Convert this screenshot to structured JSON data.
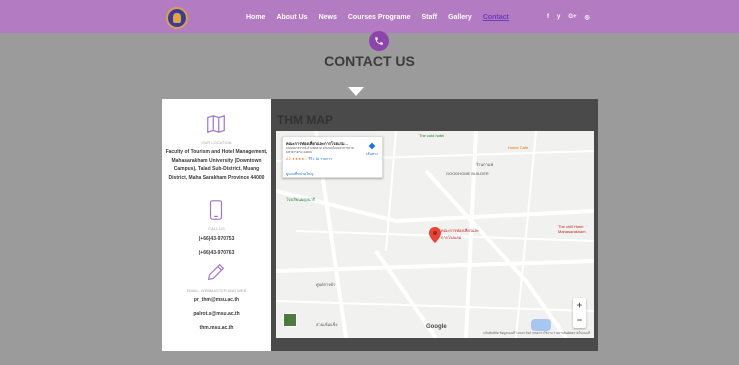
{
  "nav": {
    "items": [
      "Home",
      "About Us",
      "News",
      "Courses Programe",
      "Staff",
      "Gallery",
      "Contact"
    ],
    "active": "Contact",
    "social": [
      "f",
      "y",
      "G+",
      "◎"
    ]
  },
  "header": {
    "title": "CONTACT US"
  },
  "card": {
    "location_label": "OUR LOCATION",
    "address": "Faculty of Tourism and Hotel Management, Mahasarakham University (Downtown Campus), Talad Sub-District, Muang District, Maha Sarakham Province 44000",
    "call_label": "CALL US",
    "phone1": "(+66)43-970753",
    "phone2": "(+66)43-970763",
    "email_label": "EMAIL, WEBMASTER AND WEB",
    "email1": "pr_thm@msu.ac.th",
    "email2": "palrot.s@msu.ac.th",
    "web": "thm.msu.ac.th"
  },
  "map": {
    "title": "THM MAP",
    "place_name": "คณะการท่องเที่ยวและการโรงแรม...",
    "place_address": "ถนนนครสวรรค์ ตำบลตลาด อำเภอเมืองมหาสารคาม มหาสารคาม 44000",
    "rating": "4.2",
    "stars": "★★★★☆",
    "reviews": "รีวิว 16 รายการ",
    "directions": "เส้นทาง",
    "larger_map": "ดูแผนที่ขนาดใหญ่",
    "google": "Google",
    "attribution": "แป้นพิมพ์ลัด  ข้อมูลแผนที่ ©2023  ข้อกำหนดการใช้งาน  รายงานข้อผิดพลาดในแผนที่",
    "zoom_in": "+",
    "zoom_out": "−",
    "pin_label": "คณะการท่องเที่ยวและการโรงแรม",
    "labels": {
      "l1": "The cold hotel",
      "l2": "Home Cafe",
      "l3": "GOODHOME BUILDER",
      "l4": "ร้านกาแฟ",
      "l5": "The chill Hotel Mahasarakham",
      "l6": "โรงเรียนผดุงนารี",
      "l7": "ศูนย์การค้า",
      "l8": "สวนเข้มแข็ง"
    }
  }
}
